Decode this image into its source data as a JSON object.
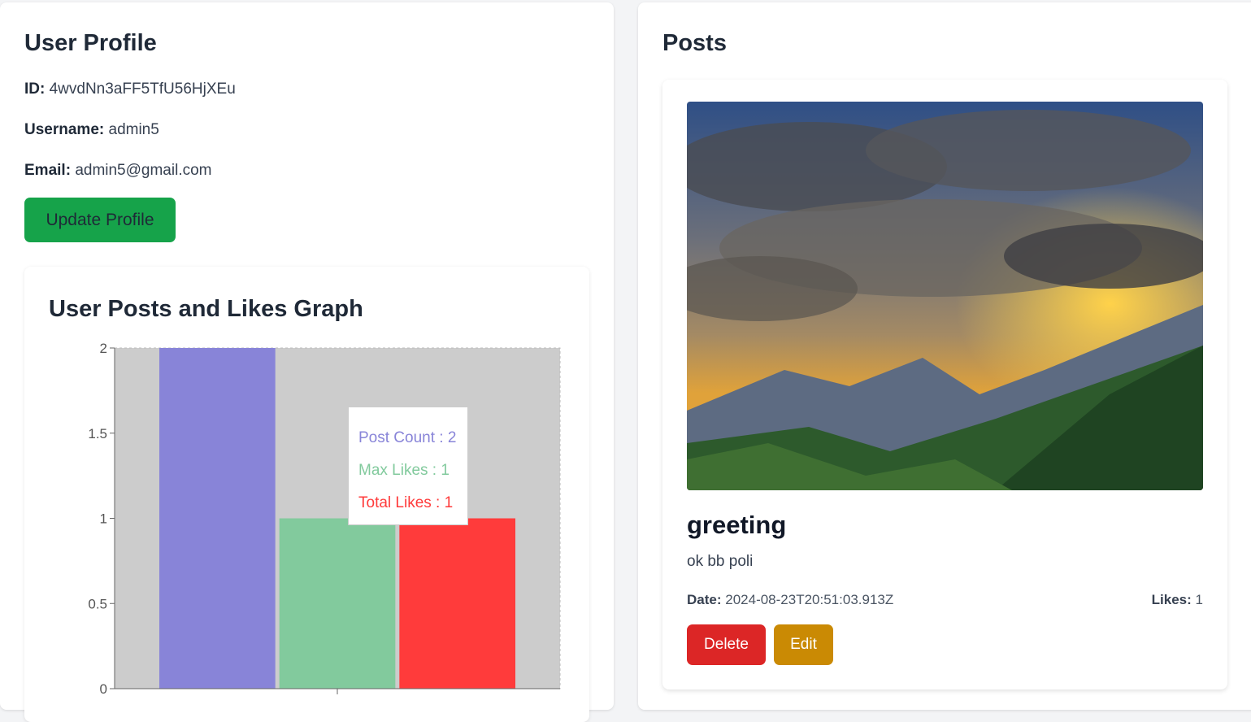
{
  "profile": {
    "title": "User Profile",
    "id_label": "ID:",
    "id_value": "4wvdNn3aFF5TfU56HjXEu",
    "username_label": "Username:",
    "username_value": "admin5",
    "email_label": "Email:",
    "email_value": "admin5@gmail.com",
    "update_button": "Update Profile"
  },
  "graph": {
    "title": "User Posts and Likes Graph",
    "tooltip": {
      "post_count": "Post Count : 2",
      "max_likes": "Max Likes : 1",
      "total_likes": "Total Likes : 1"
    }
  },
  "chart_data": {
    "type": "bar",
    "categories": [
      ""
    ],
    "series": [
      {
        "name": "Post Count",
        "values": [
          2
        ],
        "color": "#8884d8"
      },
      {
        "name": "Max Likes",
        "values": [
          1
        ],
        "color": "#82ca9d"
      },
      {
        "name": "Total Likes",
        "values": [
          1
        ],
        "color": "#ff3b3b"
      }
    ],
    "ylim": [
      0,
      2
    ],
    "yticks": [
      "0",
      "0.5",
      "1",
      "1.5",
      "2"
    ],
    "background": "#cccccc"
  },
  "posts": {
    "title": "Posts",
    "items": [
      {
        "title": "greeting",
        "body": "ok bb poli",
        "date_label": "Date:",
        "date_value": "2024-08-23T20:51:03.913Z",
        "likes_label": "Likes:",
        "likes_value": "1",
        "delete_button": "Delete",
        "edit_button": "Edit"
      }
    ]
  }
}
